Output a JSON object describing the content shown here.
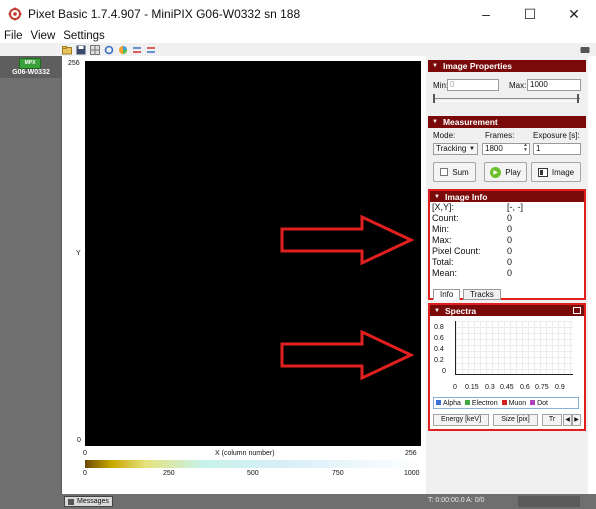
{
  "window": {
    "title": "Pixet Basic 1.7.4.907 - MiniPIX G06-W0332 sn 188",
    "minimize": "–",
    "maximize": "☐",
    "close": "✕"
  },
  "menu": [
    "File",
    "View",
    "Settings"
  ],
  "toolbar_icons": [
    "folder-icon",
    "save-icon",
    "grid-icon",
    "refresh-icon",
    "color-wheel-icon",
    "filter-icon",
    "ruler-icon"
  ],
  "device": {
    "chip_text": "MPX",
    "label": "G06-W0332"
  },
  "image": {
    "y_max": "256",
    "y_label": "Y",
    "y_min": "0",
    "x_min": "0",
    "x_label": "X (column number)",
    "x_max": "256",
    "colorbar_ticks": [
      "0",
      "250",
      "500",
      "750",
      "1000"
    ]
  },
  "image_properties": {
    "header": "Image Properties",
    "min_label": "Min:",
    "min_placeholder": "0",
    "max_label": "Max:",
    "max_value": "1000"
  },
  "measurement": {
    "header": "Measurement",
    "mode_label": "Mode:",
    "frames_label": "Frames:",
    "exposure_label": "Exposure [s]:",
    "mode_value": "Tracking",
    "frames_value": "1800",
    "exposure_value": "1",
    "sum_label": "Sum",
    "play_label": "Play",
    "image_label": "Image"
  },
  "image_info": {
    "header": "Image Info",
    "rows": [
      {
        "label": "[X,Y]:",
        "value": "[-, -]"
      },
      {
        "label": "Count:",
        "value": "0"
      },
      {
        "label": "Min:",
        "value": "0"
      },
      {
        "label": "Max:",
        "value": "0"
      },
      {
        "label": "Pixel Count:",
        "value": "0"
      },
      {
        "label": "Total:",
        "value": "0"
      },
      {
        "label": "Mean:",
        "value": "0"
      }
    ],
    "tabs": [
      "Info",
      "Tracks"
    ]
  },
  "spectra": {
    "header": "Spectra",
    "y_ticks": [
      "0.8",
      "0.6",
      "0.4",
      "0.2",
      "0"
    ],
    "x_ticks": [
      "0",
      "0.15",
      "0.3",
      "0.45",
      "0.6",
      "0.75",
      "0.9"
    ],
    "legend": [
      {
        "name": "Alpha",
        "color": "#3a6fd8"
      },
      {
        "name": "Electron",
        "color": "#3fa83f"
      },
      {
        "name": "Muon",
        "color": "#d42020"
      },
      {
        "name": "Dot",
        "color": "#b040c0"
      }
    ],
    "buttons": [
      "Energy [keV]",
      "Size [pix]",
      "Tr"
    ]
  },
  "status": {
    "messages_label": "Messages",
    "time": "T: 0:00:00.0   A: 0/0"
  },
  "colors": {
    "section_header": "#7a0a0a",
    "highlight": "#e01f1f",
    "arrow": "#e01f1f"
  }
}
